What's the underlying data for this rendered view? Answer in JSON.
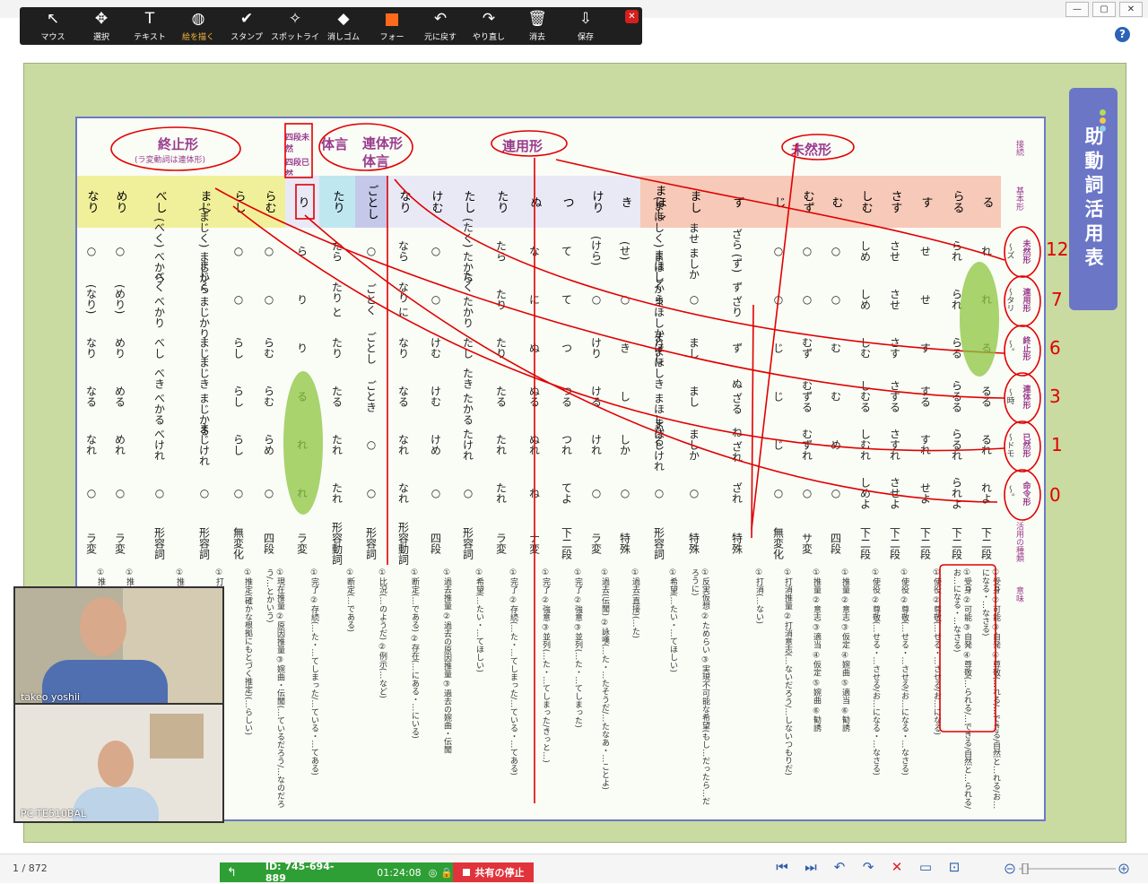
{
  "window": {
    "title": "",
    "buttons": [
      "—",
      "▢",
      "✕"
    ]
  },
  "toolbar": {
    "tools": [
      {
        "label": "マウス",
        "icon": "pointer-icon",
        "glyph": "↖"
      },
      {
        "label": "選択",
        "icon": "move-icon",
        "glyph": "✥"
      },
      {
        "label": "テキスト",
        "icon": "text-icon",
        "glyph": "T"
      },
      {
        "label": "絵を描く",
        "icon": "draw-icon",
        "glyph": "◍"
      },
      {
        "label": "スタンプ",
        "icon": "stamp-check-icon",
        "glyph": "✔"
      },
      {
        "label": "スポットライ",
        "icon": "spotlight-wand-icon",
        "glyph": "✧"
      },
      {
        "label": "消しゴム",
        "icon": "eraser-icon",
        "glyph": "◆"
      },
      {
        "label": "フォー",
        "icon": "format-color-icon",
        "glyph": ""
      },
      {
        "label": "元に戻す",
        "icon": "undo-icon",
        "glyph": "↶"
      },
      {
        "label": "やり直し",
        "icon": "redo-icon",
        "glyph": "↷"
      },
      {
        "label": "消去",
        "icon": "trash-icon",
        "glyph": "🗑"
      },
      {
        "label": "保存",
        "icon": "save-icon",
        "glyph": "⇩"
      }
    ],
    "active": "絵を描く",
    "close": "✕"
  },
  "help": "?",
  "chart": {
    "side_title": "助動詞活用表",
    "headers": {
      "shushi": "終止形",
      "shushi_note": "(ラ変動詞は連体形)",
      "mizen_masc": "四段未然",
      "izen": "四段已然",
      "taigen": "体言",
      "rentai": "連体形 体言",
      "renyou": "連用形",
      "mizen": "未然形",
      "connection": "接続",
      "basic": "基本形"
    },
    "verbs": [
      "なり",
      "めり",
      "べし",
      "まじ",
      "らし",
      "らむ",
      "り",
      "たり",
      "ごとし",
      "なり",
      "けむ",
      "たし",
      "たり",
      "ぬ",
      "つ",
      "けり",
      "き",
      "まほし",
      "まし",
      "ず",
      "じ",
      "むず",
      "む",
      "しむ",
      "さす",
      "す",
      "らる",
      "る"
    ],
    "rows": [
      {
        "label": "未然形",
        "conn": "〜ズ",
        "cells": [
          "○",
          "○",
          "(べく) べから",
          "(まじく) まじから",
          "○",
          "○",
          "ら",
          "たら",
          "○",
          "なら",
          "○",
          "(たく) たから",
          "たら",
          "な",
          "て",
          "(けら)",
          "(せ)",
          "(まほしく) まほしから",
          "ませ ましか",
          "ざら (ず)",
          "○",
          "○",
          "○",
          "しめ",
          "させ",
          "せ",
          "られ",
          "れ"
        ]
      },
      {
        "label": "連用形",
        "conn": "〜タリ",
        "cells": [
          "(なり)",
          "(めり)",
          "べく べかり",
          "まじく まじかり",
          "○",
          "○",
          "り",
          "たり と",
          "ごとく",
          "なり に",
          "○",
          "たく たかり",
          "たり",
          "に",
          "て",
          "○",
          "○",
          "まほしく まほしかり",
          "○",
          "ず ざり",
          "○",
          "○",
          "○",
          "しめ",
          "させ",
          "せ",
          "られ",
          "れ"
        ]
      },
      {
        "label": "終止形",
        "conn": "〜。",
        "cells": [
          "なり",
          "めり",
          "べし",
          "まじ",
          "らし",
          "らむ",
          "り",
          "たり",
          "ごとし",
          "なり",
          "けむ",
          "たし",
          "たり",
          "ぬ",
          "つ",
          "けり",
          "き",
          "まほし",
          "まし",
          "ず",
          "じ",
          "むず",
          "む",
          "しむ",
          "さす",
          "す",
          "らる",
          "る"
        ]
      },
      {
        "label": "連体形",
        "conn": "〜時",
        "cells": [
          "なる",
          "める",
          "べき べかる",
          "まじき まじかる",
          "らし",
          "らむ",
          "る",
          "たる",
          "ごとき",
          "なる",
          "けむ",
          "たき たかる",
          "たる",
          "ぬる",
          "つる",
          "ける",
          "し",
          "まほしき まほしかる",
          "まし",
          "ぬ ざる",
          "じ",
          "むずる",
          "む",
          "しむる",
          "さする",
          "する",
          "らるる",
          "るる"
        ]
      },
      {
        "label": "已然形",
        "conn": "〜ドモ",
        "cells": [
          "なれ",
          "めれ",
          "べけれ",
          "まじけれ",
          "らし",
          "らめ",
          "れ",
          "たれ",
          "○",
          "なれ",
          "けめ",
          "たけれ",
          "たれ",
          "ぬれ",
          "つれ",
          "けれ",
          "しか",
          "まほしけれ",
          "ましか",
          "ね ざれ",
          "じ",
          "むずれ",
          "め",
          "しむれ",
          "さすれ",
          "すれ",
          "らるれ",
          "るれ"
        ]
      },
      {
        "label": "命令形",
        "conn": "〜。",
        "cells": [
          "○",
          "○",
          "○",
          "○",
          "○",
          "○",
          "れ",
          "たれ",
          "○",
          "なれ",
          "○",
          "○",
          "たれ",
          "ね",
          "てよ",
          "○",
          "○",
          "○",
          "○",
          "ざれ",
          "○",
          "○",
          "○",
          "しめよ",
          "させよ",
          "せよ",
          "られよ",
          "れよ"
        ]
      }
    ],
    "types": [
      "ラ変",
      "ラ変",
      "形容詞",
      "形容詞",
      "無変化",
      "四段",
      "ラ変",
      "形容動詞",
      "形容詞",
      "形容動詞",
      "四段",
      "形容詞",
      "ラ変",
      "ナ変",
      "下二段",
      "ラ変",
      "特殊",
      "形容詞",
      "特殊",
      "特殊",
      "無変化",
      "サ変",
      "四段",
      "下二段",
      "下二段",
      "下二段",
      "下二段",
      "下二段"
    ],
    "type_labels": {
      "conn_col": "活用の種類",
      "meaning_col": "意味"
    },
    "meanings": [
      "①推定(…ようだ) ②伝聞(…そうだ)",
      "①推定 ②婉曲(…ようだ)",
      "①推量 ②意志 ③可能 ④当然 ⑤命令 ⑥適当 予定",
      "①打消推量 ②打消意志 ③不可能 ④打消当然 ⑤禁止 ⑥不適当",
      "①推定(確かな根拠にもとづく推定)(…らしい)",
      "①現在推量 ②原因推量 ③婉曲・伝聞(…ているだろう/…なのだろう/…とかいう)",
      "①完了 ②存続(…た・…てしまった/…ている・…てある)",
      "①断定(…である)",
      "①比況(…のようだ) ②例示(…など)",
      "①断定(…である) ②存在(…にある・…にいる)",
      "①過去推量 ②過去の原因推量 ③過去の婉曲・伝聞",
      "①希望(…たい・…てほしい)",
      "①完了 ②存続(…た・…てしまった/…ている・…てある)",
      "①完了 ②強意 ③並列(…た・…てしまった/きっと…)",
      "①完了 ②強意 ③並列(…た・…てしまった)",
      "①過去(伝聞) ②詠嘆(…た・…たそうだ/…たなあ・…ことよ)",
      "①過去(直接)(…た)",
      "①希望(…たい・…てほしい)",
      "①反実仮想 ②ためらい ③実現不可能な希望(もし…だったら…だろうに)",
      "①打消(…ない)",
      "①打消推量 ②打消意志(…ないだろう/…しないつもりだ)",
      "①推量 ②意志 ③適当 ④仮定 ⑤婉曲 ⑥勧誘",
      "①推量 ②意志 ③仮定 ④婉曲 ⑤適当 ⑥勧誘",
      "①使役 ②尊敬(…せる・…させる/お…になる・…なさる)",
      "①使役 ②尊敬(…せる・…させる/お…になる・…なさる)",
      "①使役 ②尊敬(…せる・…させる/お…になる)",
      "①受身 ②可能 ③自発 ④尊敬(…られる/…できる/自然と…られる/お…になる・…なさる)",
      "①受身 ②可能 ③自発 ④尊敬(…れる/…できる/自然と…れる/お…になる・…なさる)"
    ],
    "annotations": [
      "12",
      "7",
      "6",
      "3",
      "1",
      "0"
    ]
  },
  "participants": [
    {
      "name": "takeo yoshii"
    },
    {
      "name": "PC-TE510BAL"
    }
  ],
  "status": {
    "page": "1 / 872",
    "meeting_id": "ID: 745-694-889",
    "elapsed": "01:24:08",
    "stop_share": "共有の停止"
  },
  "colors": {
    "accent": "#6b76c6",
    "highlight": "#e6f09a",
    "pen": "#e00000",
    "share_green": "#2e9f34",
    "stop_red": "#e0333b"
  }
}
